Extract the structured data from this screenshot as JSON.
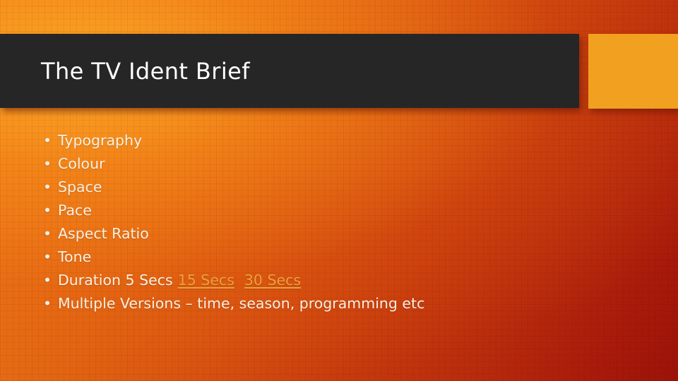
{
  "slide": {
    "title": "The TV Ident Brief",
    "background": {
      "gradient_from": "#f28a1c",
      "gradient_to": "#9e1208"
    },
    "title_bar": {
      "color": "#262626",
      "text_color": "#ffffff"
    },
    "accent_block": {
      "color": "#f2a01f",
      "label": ""
    },
    "bullets": [
      {
        "text": "Typography"
      },
      {
        "text": "Colour"
      },
      {
        "text": "Space"
      },
      {
        "text": "Pace"
      },
      {
        "text": "Aspect Ratio"
      },
      {
        "text": "Tone"
      },
      {
        "text": "Duration 5 Secs",
        "link1": "15 Secs",
        "link2": "30 Secs"
      },
      {
        "text": "Multiple Versions – time, season,  programming etc"
      }
    ],
    "bullet_glyph": "•",
    "bullet_text_color": "#f7f1e3",
    "link_color": "#e8a33d"
  }
}
